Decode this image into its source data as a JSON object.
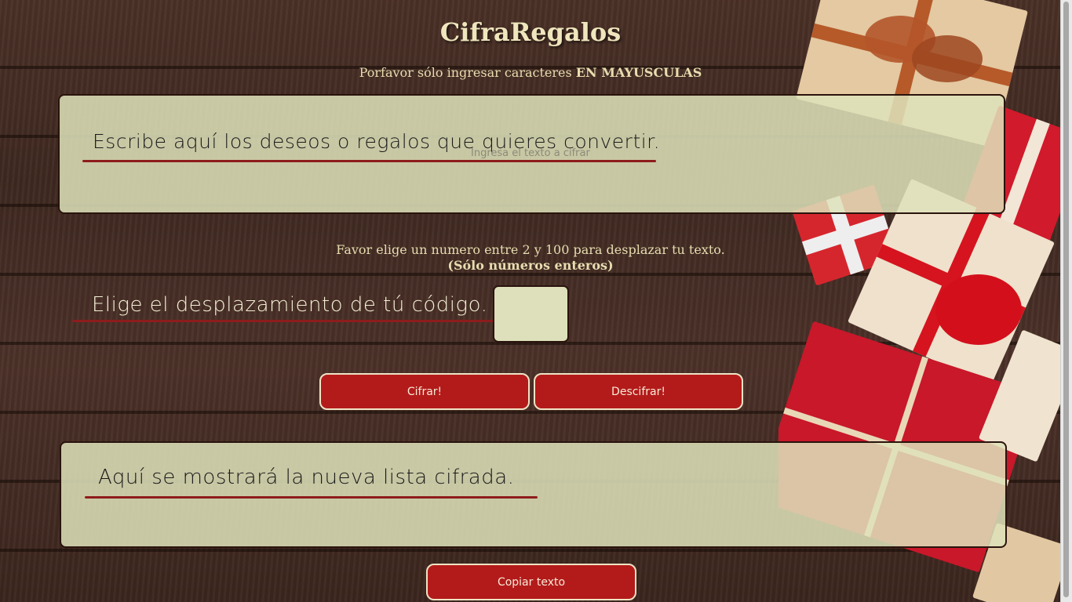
{
  "header": {
    "title": "CifraRegalos",
    "subtitle_prefix": "Porfavor sólo ingresar caracteres ",
    "subtitle_emphasis": "EN MAYUSCULAS"
  },
  "input_panel": {
    "label": "Escribe aquí los deseos o regalos que quieres convertir.",
    "placeholder": "Ingresa el texto a cifrar",
    "value": ""
  },
  "shift": {
    "instruction": "Favor elige un numero entre 2 y 100 para desplazar tu texto.",
    "instruction_note": "(Sólo números enteros)",
    "label": "Elige el desplazamiento de tú código.",
    "value": ""
  },
  "actions": {
    "encrypt_label": "Cifrar!",
    "decrypt_label": "Descifrar!",
    "copy_label": "Copiar texto"
  },
  "output_panel": {
    "label": "Aquí se mostrará la nueva lista cifrada.",
    "value": ""
  },
  "colors": {
    "button": "#b31b1b",
    "panel": "#dee2ba",
    "accent_line": "#8e1c1c",
    "heading": "#efe6bd"
  }
}
